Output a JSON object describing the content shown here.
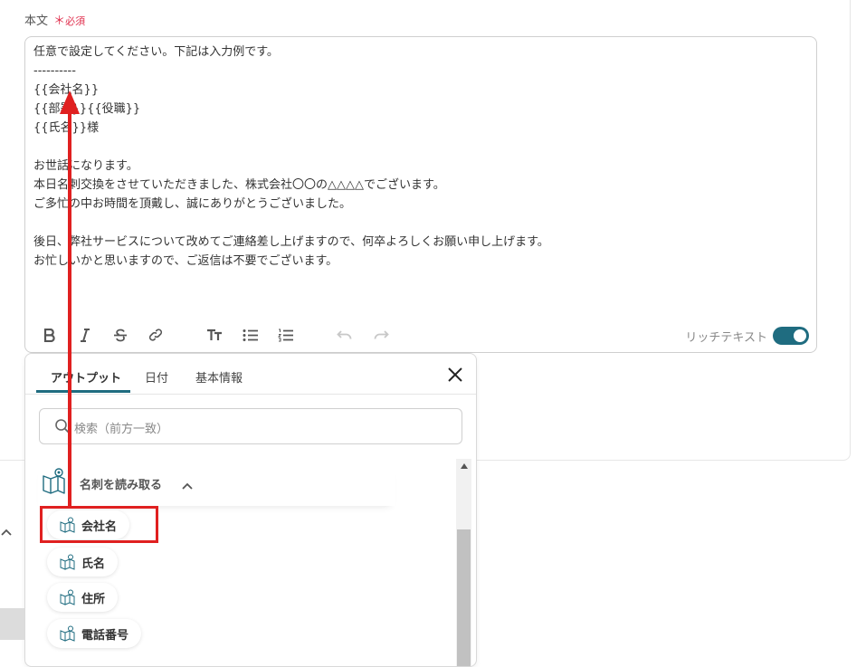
{
  "field": {
    "label": "本文",
    "required_mark": "＊",
    "required_text": "必須"
  },
  "editor": {
    "lines": [
      "任意で設定してください。下記は入力例です。",
      "----------",
      "{{会社名}}",
      "{{部署}}{{役職}}",
      "{{氏名}}様",
      "",
      "お世話になります。",
      "本日名刺交換をさせていただきました、株式会社〇〇の△△△△でございます。",
      "ご多忙の中お時間を頂戴し、誠にありがとうございました。",
      "",
      "後日、弊社サービスについて改めてご連絡差し上げますので、何卒よろしくお願い申し上げます。",
      "お忙しいかと思いますので、ご返信は不要でございます。"
    ],
    "toolbar": {
      "icons": [
        "bold-icon",
        "italic-icon",
        "strikethrough-icon",
        "link-icon",
        "text-size-icon",
        "bullet-list-icon",
        "numbered-list-icon",
        "undo-icon",
        "redo-icon"
      ],
      "rich_text_label": "リッチテキスト",
      "rich_text_enabled": true
    }
  },
  "panel": {
    "tabs": [
      {
        "label": "アウトプット",
        "active": true
      },
      {
        "label": "日付",
        "active": false
      },
      {
        "label": "基本情報",
        "active": false
      }
    ],
    "search_placeholder": "検索（前方一致）",
    "group": {
      "label": "名刺を読み取る",
      "icon": "business-card-reader-icon",
      "expanded": true
    },
    "items": [
      {
        "label": "会社名",
        "highlighted": true
      },
      {
        "label": "氏名"
      },
      {
        "label": "住所"
      },
      {
        "label": "電話番号"
      }
    ]
  },
  "colors": {
    "accent": "#1f6c80",
    "required": "#e0304e",
    "annotation": "#e02020"
  }
}
